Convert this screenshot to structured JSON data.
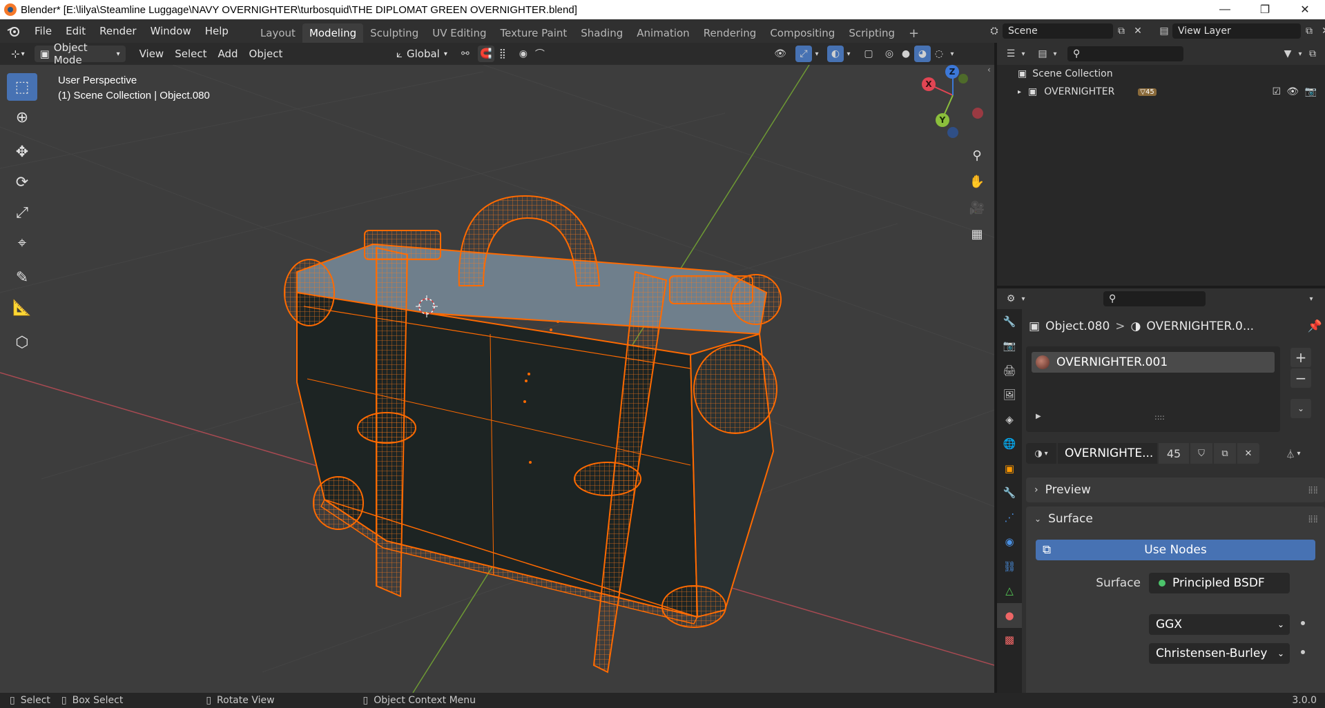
{
  "window": {
    "title": "Blender* [E:\\lilya\\Steamline Luggage\\NAVY OVERNIGHTER\\turbosquid\\THE DIPLOMAT GREEN OVERNIGHTER.blend]",
    "minimize": "—",
    "restore": "❐",
    "close": "✕"
  },
  "topbar": {
    "menus": [
      "File",
      "Edit",
      "Render",
      "Window",
      "Help"
    ],
    "workspaces": [
      "Layout",
      "Modeling",
      "Sculpting",
      "UV Editing",
      "Texture Paint",
      "Shading",
      "Animation",
      "Rendering",
      "Compositing",
      "Scripting"
    ],
    "active_workspace": "Modeling",
    "add_workspace": "+",
    "scene": "Scene",
    "view_layer": "View Layer"
  },
  "viewport_header": {
    "mode": "Object Mode",
    "menus": [
      "View",
      "Select",
      "Add",
      "Object"
    ],
    "orientation": "Global"
  },
  "viewport": {
    "perspective": "User Perspective",
    "collection_info": "(1) Scene Collection | Object.080",
    "gizmo": {
      "x": "X",
      "y": "Y",
      "z": "Z"
    }
  },
  "outliner": {
    "root": "Scene Collection",
    "collection": "OVERNIGHTER",
    "collection_count": "45"
  },
  "properties": {
    "breadcrumb_object": "Object.080",
    "breadcrumb_sep": ">",
    "breadcrumb_material": "OVERNIGHTER.0...",
    "material_slot": "OVERNIGHTER.001",
    "slot_grip": "::::",
    "material_name": "OVERNIGHTE...",
    "material_users": "45",
    "panels": {
      "preview": "Preview",
      "surface": "Surface"
    },
    "use_nodes": "Use Nodes",
    "surface_label": "Surface",
    "surface_shader": "Principled BSDF",
    "distribution": "GGX",
    "subsurface": "Christensen-Burley"
  },
  "statusbar": {
    "select": "Select",
    "box_select": "Box Select",
    "rotate_view": "Rotate View",
    "context_menu": "Object Context Menu",
    "version": "3.0.0"
  },
  "colors": {
    "accent_blue": "#4772b3",
    "selection_orange": "#ff6a00",
    "axis_x": "#e14553",
    "axis_y": "#8bbf3c",
    "axis_z": "#3c78d8"
  }
}
